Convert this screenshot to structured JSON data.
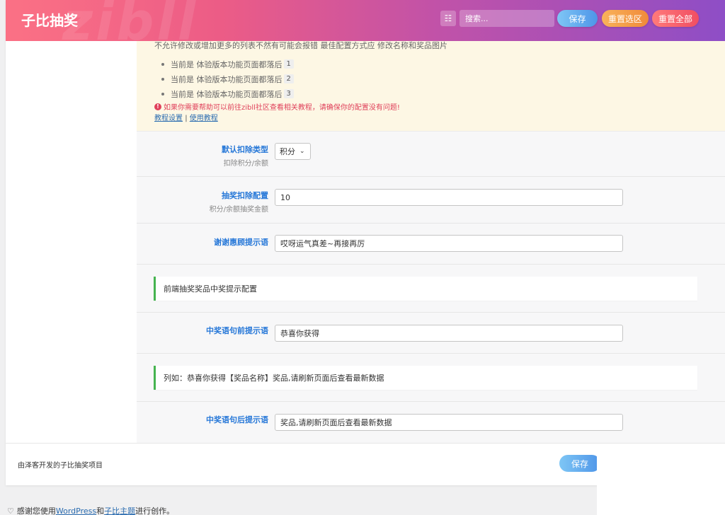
{
  "header": {
    "title": "子比抽奖",
    "watermark": "zibll",
    "menu_icon": "list-icon",
    "search_placeholder": "搜索...",
    "save_label": "保存",
    "reset_section_label": "重置选区",
    "reset_all_label": "重置全部"
  },
  "notice": {
    "top_line": "不允许修改或增加更多的列表不然有可能会报错 最佳配置方式应 修改名称和奖品图片",
    "items": [
      {
        "text": "当前是 体验版本功能页面都落后",
        "num": "1"
      },
      {
        "text": "当前是 体验版本功能页面都落后",
        "num": "2"
      },
      {
        "text": "当前是 体验版本功能页面都落后",
        "num": "3"
      }
    ],
    "help_text": "如果你需要帮助可以前往zibll社区查看相关教程，请确保你的配置没有问题!",
    "link_tutorial_settings": "教程设置",
    "link_separator": "|",
    "link_usage_tutorial": "使用教程"
  },
  "fields": {
    "deduct_type": {
      "label": "默认扣除类型",
      "sub": "扣除积分/余额",
      "value": "积分"
    },
    "deduct_amount": {
      "label": "抽奖扣除配置",
      "sub": "积分/余额抽奖金额",
      "value": "10"
    },
    "thanks_msg": {
      "label": "谢谢惠顾提示语",
      "value": "哎呀运气真差~再接再厉"
    },
    "prefix_msg": {
      "label": "中奖语句前提示语",
      "value": "恭喜你获得"
    },
    "suffix_msg": {
      "label": "中奖语句后提示语",
      "value": "奖品,请刷新页面后查看最新数据"
    }
  },
  "callouts": {
    "frontend_config": "前端抽奖奖品中奖提示配置",
    "example": "列如：恭喜你获得【奖品名称】奖品,请刷新页面后查看最新数据"
  },
  "footer": {
    "credit": "由泽客开发的子比抽奖项目",
    "save_label": "保存"
  },
  "wp_footer": {
    "prefix": "感谢您使用",
    "wordpress": "WordPress",
    "and": "和",
    "theme": "子比主题",
    "suffix": "进行创作。"
  },
  "colors": {
    "accent": "#2778d8",
    "callout_border": "#46b450",
    "notice_bg": "#fdf7e4",
    "help_red": "#e0405a"
  }
}
